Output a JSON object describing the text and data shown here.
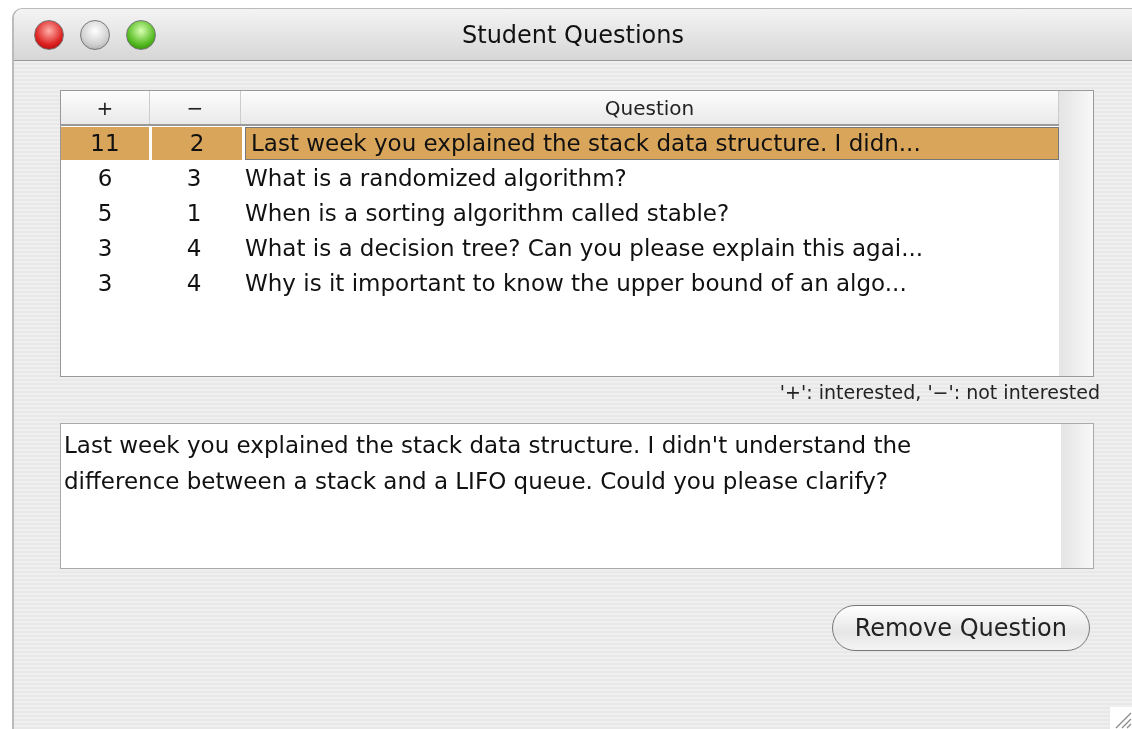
{
  "window": {
    "title": "Student Questions"
  },
  "table": {
    "columns": [
      "+",
      "−",
      "Question"
    ],
    "rows": [
      {
        "plus": "11",
        "minus": "2",
        "question": "Last week you explained the stack data structure. I didn...",
        "selected": true
      },
      {
        "plus": "6",
        "minus": "3",
        "question": "What is a randomized algorithm?",
        "selected": false
      },
      {
        "plus": "5",
        "minus": "1",
        "question": "When is a sorting algorithm called stable?",
        "selected": false
      },
      {
        "plus": "3",
        "minus": "4",
        "question": "What is a decision tree? Can you please explain this agai...",
        "selected": false
      },
      {
        "plus": "3",
        "minus": "4",
        "question": "Why is it important to know the upper bound of an algo...",
        "selected": false
      }
    ]
  },
  "legend": "'+': interested, '−': not interested",
  "detail": {
    "value": "Last week you explained the stack data structure. I didn't understand the difference between a stack and a LIFO queue. Could you please clarify?"
  },
  "buttons": [
    "Remove Question"
  ]
}
